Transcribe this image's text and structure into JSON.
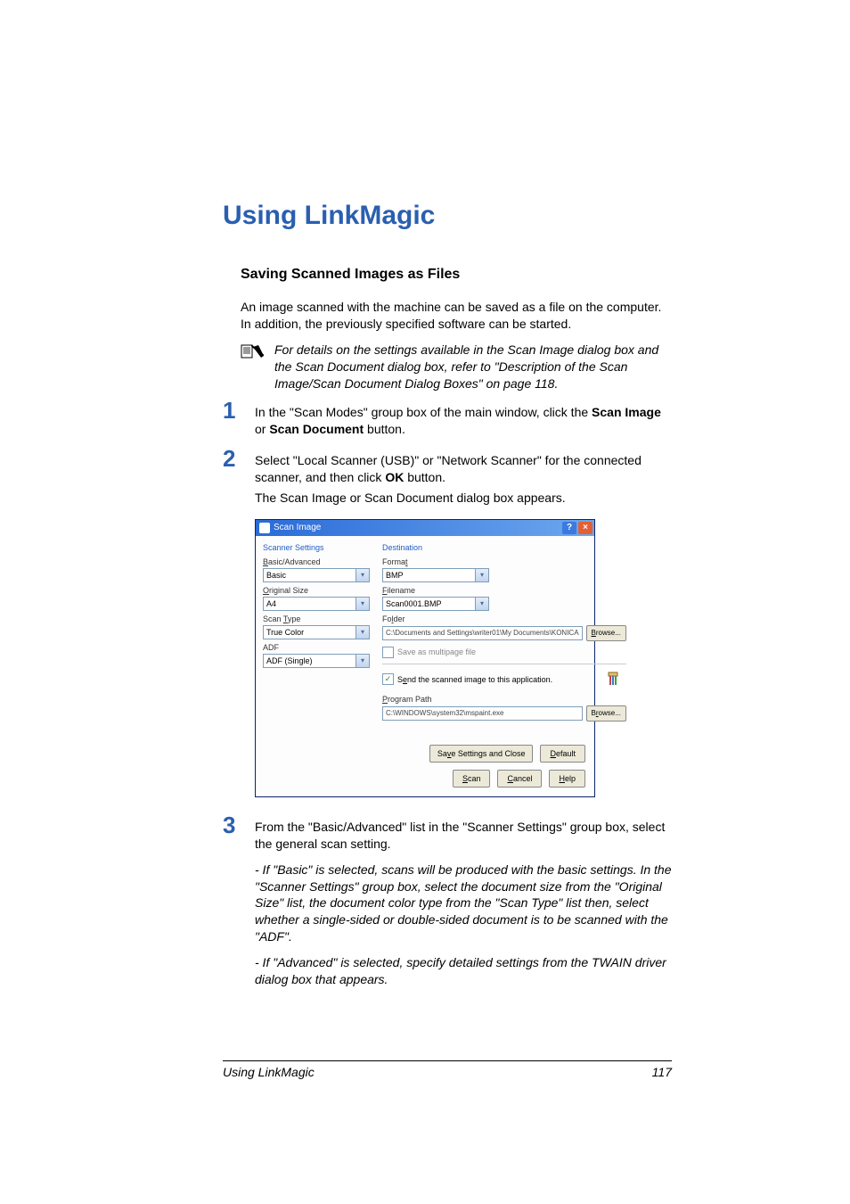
{
  "heading": "Using LinkMagic",
  "subheading": "Saving Scanned Images as Files",
  "intro1": "An image scanned with the machine can be saved as a file on the computer. In addition, the previously specified software can be started.",
  "note": "For details on the settings available in the Scan Image dialog box and the Scan Document dialog box, refer to \"Description of the Scan Image/Scan Document Dialog Boxes\" on page 118.",
  "steps": {
    "s1a": "In the \"Scan Modes\" group box of the main window, click the ",
    "s1_b1": "Scan Image",
    "s1b": " or ",
    "s1_b2": "Scan Document",
    "s1c": " button.",
    "s2a": "Select \"Local Scanner (USB)\" or \"Network Scanner\" for the connected scanner, and then click ",
    "s2_b1": "OK",
    "s2b": " button.",
    "s2c": "The Scan Image or Scan Document dialog box appears.",
    "s3": "From the \"Basic/Advanced\" list in the \"Scanner Settings\" group box, select the general scan setting.",
    "sub1": "- If \"Basic\" is selected, scans will be produced with the basic settings. In the \"Scanner Settings\" group box, select the document size from the \"Original Size\" list, the document color type from the \"Scan Type\" list then, select whether a single-sided or double-sided document is to be scanned with the \"ADF\".",
    "sub2": "- If \"Advanced\" is selected, specify detailed settings from the TWAIN driver dialog box that appears."
  },
  "dialog": {
    "title": "Scan Image",
    "left": {
      "section": "Scanner Settings",
      "basic_adv_label": "Basic/Advanced",
      "basic_adv_value": "Basic",
      "orig_size_label": "Original Size",
      "orig_size_value": "A4",
      "scan_type_label": "Scan Type",
      "scan_type_value": "True Color",
      "adf_label": "ADF",
      "adf_value": "ADF (Single)"
    },
    "right": {
      "section": "Destination",
      "format_label": "Format",
      "format_value": "BMP",
      "filename_label": "Filename",
      "filename_value": "Scan0001.BMP",
      "folder_label": "Folder",
      "folder_value": "C:\\Documents and Settings\\writer01\\My Documents\\KONICA",
      "browse1": "Browse...",
      "multipage": "Save as multipage file",
      "send_app": "Send the scanned image to this application.",
      "program_path_label": "Program Path",
      "program_path_value": "C:\\WINDOWS\\system32\\mspaint.exe",
      "browse2": "Browse..."
    },
    "footer": {
      "save_close": "Save Settings and Close",
      "default": "Default",
      "scan": "Scan",
      "cancel": "Cancel",
      "help": "Help"
    }
  },
  "footer_text": "Using LinkMagic",
  "footer_page": "117"
}
